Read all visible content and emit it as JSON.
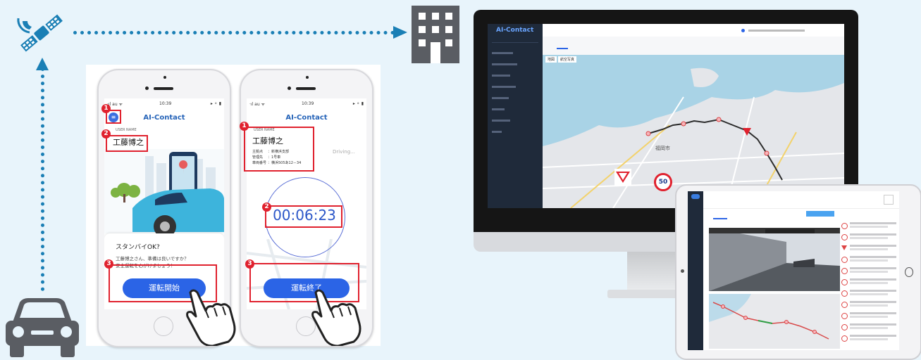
{
  "app_name": "AI-Contact",
  "phone1": {
    "time": "10:39",
    "app_title": "AI-Contact",
    "user_label": "USER NAME",
    "user_name": "工藤博之",
    "standby_title": "スタンバイOK?",
    "standby_msg1": "工藤博之さん、準備は良いですか？",
    "standby_msg2": "安全運転を心がけましょう！",
    "button": "運転開始",
    "badges": [
      "1",
      "2",
      "3"
    ]
  },
  "phone2": {
    "time": "10:39",
    "app_title": "AI-Contact",
    "user_label": "USER NAME",
    "user_name": "工藤博之",
    "info_rows": [
      {
        "label": "主拠点",
        "value": "：新横浜支部"
      },
      {
        "label": "管理先",
        "value": "：1号車"
      },
      {
        "label": "車両番号",
        "value": "：横浜505あ12－34"
      }
    ],
    "driving": "Driving...",
    "timer": "00:06:23",
    "button": "運転終了",
    "badges": [
      "1",
      "2",
      "3"
    ]
  },
  "monitor": {
    "map_city": "福岡市",
    "speed_sign": "50",
    "tab_map": "地図",
    "tab_photo": "航空写真"
  },
  "colors": {
    "accent": "#1a7fb5",
    "icon_gray": "#5a5d63",
    "red": "#e0212e",
    "button_blue": "#2b64e6"
  },
  "icons": [
    "satellite-icon",
    "building-icon",
    "car-icon",
    "hand-pointer-icon"
  ]
}
